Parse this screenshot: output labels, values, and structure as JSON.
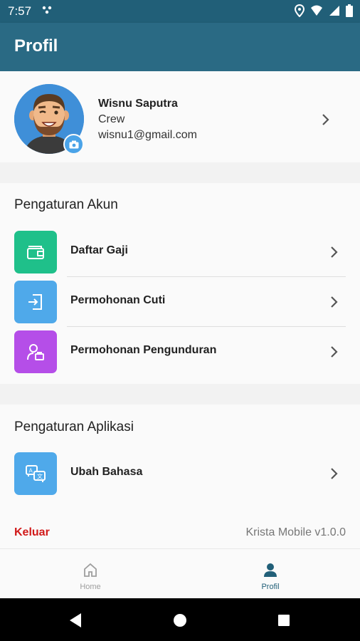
{
  "status_bar": {
    "time": "7:57"
  },
  "app_bar": {
    "title": "Profil"
  },
  "profile": {
    "name": "Wisnu Saputra",
    "role": "Crew",
    "email": "wisnu1@gmail.com"
  },
  "account_settings": {
    "title": "Pengaturan Akun",
    "items": [
      {
        "label": "Daftar Gaji",
        "icon": "wallet-icon",
        "color": "#1fc08a"
      },
      {
        "label": "Permohonan Cuti",
        "icon": "leave-request-icon",
        "color": "#4fa9ea"
      },
      {
        "label": "Permohonan Pengunduran",
        "icon": "resignation-icon",
        "color": "#b54ee8"
      }
    ]
  },
  "app_settings": {
    "title": "Pengaturan Aplikasi",
    "items": [
      {
        "label": "Ubah Bahasa",
        "icon": "translate-icon",
        "color": "#4fa9ea"
      }
    ]
  },
  "footer": {
    "logout_label": "Keluar",
    "version": "Krista Mobile v1.0.0"
  },
  "bottom_nav": {
    "items": [
      {
        "label": "Home",
        "active": false
      },
      {
        "label": "Profil",
        "active": true
      }
    ]
  },
  "colors": {
    "primary": "#2a6a84",
    "logout": "#d11a1a",
    "active_nav": "#215f78",
    "inactive_nav": "#9e9e9e"
  }
}
